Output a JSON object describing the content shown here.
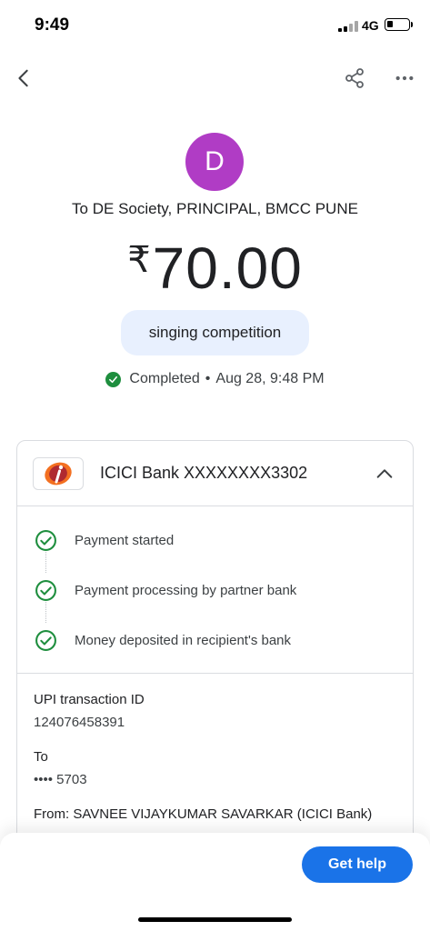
{
  "status_bar": {
    "time": "9:49",
    "network": "4G"
  },
  "top_bar": {
    "back_icon": "chevron-left-icon",
    "share_icon": "share-icon",
    "more_icon": "more-horizontal-icon"
  },
  "payment": {
    "avatar_letter": "D",
    "avatar_color": "#b03cc5",
    "recipient": "To DE Society, PRINCIPAL, BMCC PUNE",
    "currency_symbol": "₹",
    "amount": "70.00",
    "note": "singing competition",
    "status": "Completed",
    "separator": "•",
    "datetime": "Aug 28, 9:48 PM",
    "status_color": "#1e8e3e"
  },
  "card": {
    "bank": {
      "logo_icon": "icici-logo-icon",
      "name": "ICICI Bank XXXXXXXX3302",
      "collapse_icon": "chevron-up-icon"
    },
    "steps": [
      {
        "label": "Payment started"
      },
      {
        "label": "Payment processing by partner bank"
      },
      {
        "label": "Money deposited in recipient's bank"
      }
    ],
    "details": {
      "upi_label": "UPI transaction ID",
      "upi_value": "124076458391",
      "to_label": "To",
      "to_value": "•••• 5703",
      "from_label": "From: SAVNEE VIJAYKUMAR SAVARKAR (ICICI Bank)"
    }
  },
  "footer": {
    "help_label": "Get help",
    "help_color": "#1a73e8"
  }
}
